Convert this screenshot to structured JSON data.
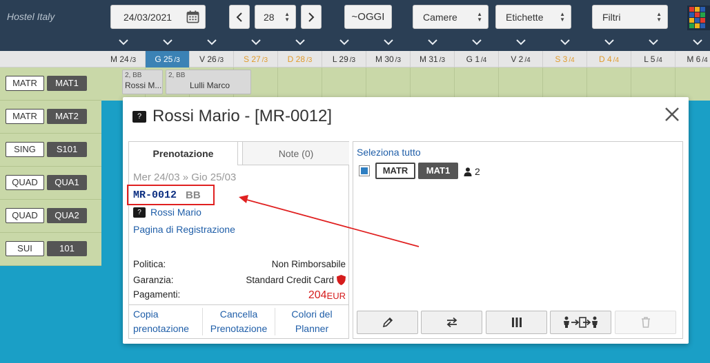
{
  "app": {
    "title": "Hostel Italy"
  },
  "toolbar": {
    "date_value": "24/03/2021",
    "days_value": "28",
    "today_label": "~OGGI",
    "rooms_dropdown": "Camere",
    "labels_dropdown": "Etichette",
    "filters_dropdown": "Filtri"
  },
  "days": [
    {
      "wd": "M",
      "d": "24",
      "m": "/3",
      "kind": "normal"
    },
    {
      "wd": "G",
      "d": "25",
      "m": "/3",
      "kind": "today"
    },
    {
      "wd": "V",
      "d": "26",
      "m": "/3",
      "kind": "normal"
    },
    {
      "wd": "S",
      "d": "27",
      "m": "/3",
      "kind": "weekend"
    },
    {
      "wd": "D",
      "d": "28",
      "m": "/3",
      "kind": "weekend"
    },
    {
      "wd": "L",
      "d": "29",
      "m": "/3",
      "kind": "normal"
    },
    {
      "wd": "M",
      "d": "30",
      "m": "/3",
      "kind": "normal"
    },
    {
      "wd": "M",
      "d": "31",
      "m": "/3",
      "kind": "normal"
    },
    {
      "wd": "G",
      "d": "1",
      "m": "/4",
      "kind": "normal"
    },
    {
      "wd": "V",
      "d": "2",
      "m": "/4",
      "kind": "normal"
    },
    {
      "wd": "S",
      "d": "3",
      "m": "/4",
      "kind": "weekend"
    },
    {
      "wd": "D",
      "d": "4",
      "m": "/4",
      "kind": "weekend"
    },
    {
      "wd": "L",
      "d": "5",
      "m": "/4",
      "kind": "normal"
    },
    {
      "wd": "M",
      "d": "6",
      "m": "/4",
      "kind": "normal"
    }
  ],
  "rooms": [
    {
      "type": "MATR",
      "code": "MAT1"
    },
    {
      "type": "MATR",
      "code": "MAT2"
    },
    {
      "type": "SING",
      "code": "S101"
    },
    {
      "type": "QUAD",
      "code": "QUA1"
    },
    {
      "type": "QUAD",
      "code": "QUA2"
    },
    {
      "type": "SUI",
      "code": "101"
    }
  ],
  "bookings": [
    {
      "top": "2, BB",
      "name": "Rossi M..."
    },
    {
      "top": "2, BB",
      "name": "Lulli Marco"
    }
  ],
  "modal": {
    "guest_icon": "?",
    "title": "Rossi Mario - [MR-0012]",
    "tab_booking": "Prenotazione",
    "tab_notes": "Note (0)",
    "dates": "Mer 24/03 » Gio 25/03",
    "res_code": "MR-0012",
    "res_plan": "BB",
    "guest_name": "Rossi Mario",
    "registration_link": "Pagina di Registrazione",
    "policy_label": "Politica:",
    "policy_value": "Non Rimborsabile",
    "guarantee_label": "Garanzia:",
    "guarantee_value": "Standard Credit Card",
    "payments_label": "Pagamenti:",
    "payments_amount": "204",
    "payments_currency": "EUR",
    "action_copy": [
      "Copia",
      "prenotazione"
    ],
    "action_cancel": [
      "Cancella",
      "Prenotazione"
    ],
    "action_colors": [
      "Colori del",
      "Planner"
    ],
    "select_all": "Seleziona tutto",
    "room_type": "MATR",
    "room_code": "MAT1",
    "guests": "2"
  },
  "colors": {
    "topbar": "#2b3f55",
    "background": "#1a9fc6",
    "today": "#3b82b5",
    "weekend": "#e09b2d",
    "link": "#1f5ea8",
    "highlight": "#e02020",
    "payment": "#d51c1c"
  },
  "icons": {
    "calendar": "calendar-icon",
    "prev": "chevron-left-icon",
    "next": "chevron-right-icon",
    "close": "close-icon",
    "shield": "shield-icon",
    "person": "person-icon",
    "edit": "pencil-icon",
    "swap": "swap-arrows-icon",
    "split": "split-icon",
    "move": "move-guests-icon",
    "delete": "trash-icon"
  }
}
